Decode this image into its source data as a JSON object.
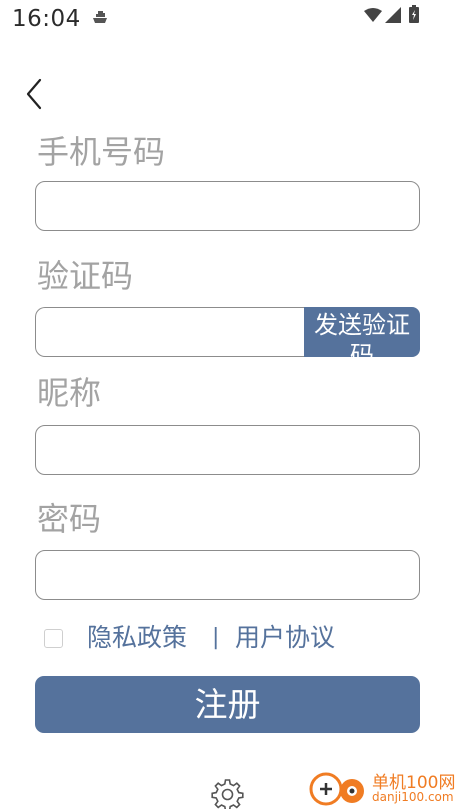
{
  "status_bar": {
    "time": "16:04"
  },
  "form": {
    "phone_label": "手机号码",
    "phone_value": "",
    "code_label": "验证码",
    "code_value": "",
    "send_code_label": "发送验证码",
    "nickname_label": "昵称",
    "nickname_value": "",
    "password_label": "密码",
    "password_value": ""
  },
  "agreement": {
    "privacy_link": "隐私政策",
    "separator": "|",
    "user_agreement_link": "用户协议"
  },
  "register_button": "注册",
  "watermark": {
    "brand": "单机100网",
    "domain": "danji100.com"
  },
  "colors": {
    "accent": "#55729c",
    "label": "#a3a3a3",
    "watermark": "#f07c23"
  },
  "icons": [
    "notification-icon",
    "wifi-icon",
    "signal-icon",
    "battery-icon",
    "back-arrow-icon",
    "gear-icon"
  ]
}
